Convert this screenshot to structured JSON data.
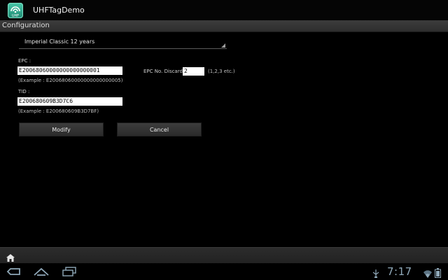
{
  "app": {
    "title": "UHFTagDemo",
    "icon": "uhf-app-icon"
  },
  "section": {
    "title": "Configuration"
  },
  "spinner": {
    "selected": "Imperial Classic 12 years"
  },
  "epc": {
    "label": "EPC :",
    "value": "E20068060000000000000001",
    "example": "(Example : E20068060000000000000005)"
  },
  "epc_discard": {
    "label": "EPC No. Discard:",
    "value": "2",
    "hint": "(1,2,3 etc.)"
  },
  "tid": {
    "label": "TID :",
    "value": "E200680609B3D7C6",
    "example": "(Example : E200680609B3D7BF)"
  },
  "buttons": {
    "modify": "Modify",
    "cancel": "Cancel"
  },
  "system": {
    "clock": "7:17"
  },
  "colors": {
    "background": "#000000",
    "action_bar": "#050505",
    "config_bar": "#363636",
    "clock": "#8fa8b8"
  }
}
